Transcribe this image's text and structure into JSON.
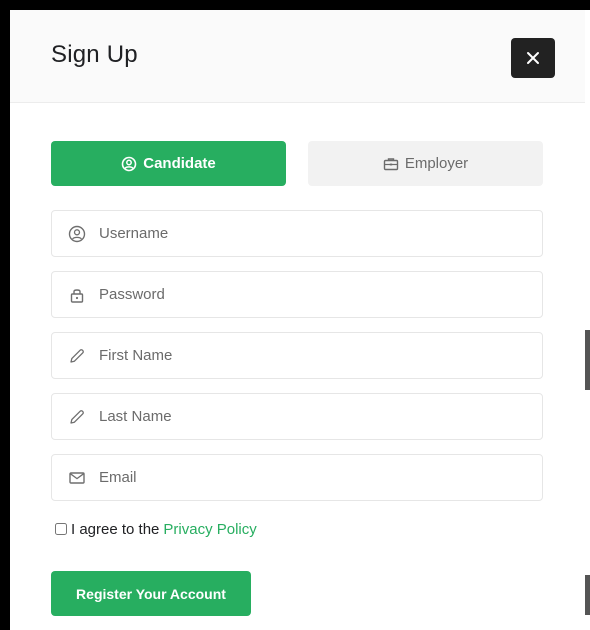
{
  "modal": {
    "title": "Sign Up",
    "close_icon": "close-icon"
  },
  "tabs": [
    {
      "label": "Candidate",
      "icon": "user-circle-icon",
      "active": true
    },
    {
      "label": "Employer",
      "icon": "briefcase-icon",
      "active": false
    }
  ],
  "fields": {
    "username": {
      "placeholder": "Username",
      "value": "",
      "icon": "user-circle-icon"
    },
    "password": {
      "placeholder": "Password",
      "value": "",
      "icon": "lock-icon"
    },
    "first_name": {
      "placeholder": "First Name",
      "value": "",
      "icon": "pencil-icon"
    },
    "last_name": {
      "placeholder": "Last Name",
      "value": "",
      "icon": "pencil-icon"
    },
    "email": {
      "placeholder": "Email",
      "value": "",
      "icon": "envelope-icon"
    }
  },
  "agreement": {
    "text": "I agree to the",
    "link_text": "Privacy Policy",
    "checked": false
  },
  "register": {
    "label": "Register Your Account"
  },
  "colors": {
    "accent": "#27ae60",
    "header_bg": "#fafafa",
    "close_bg": "#222222",
    "inactive_tab_bg": "#f2f2f2"
  }
}
